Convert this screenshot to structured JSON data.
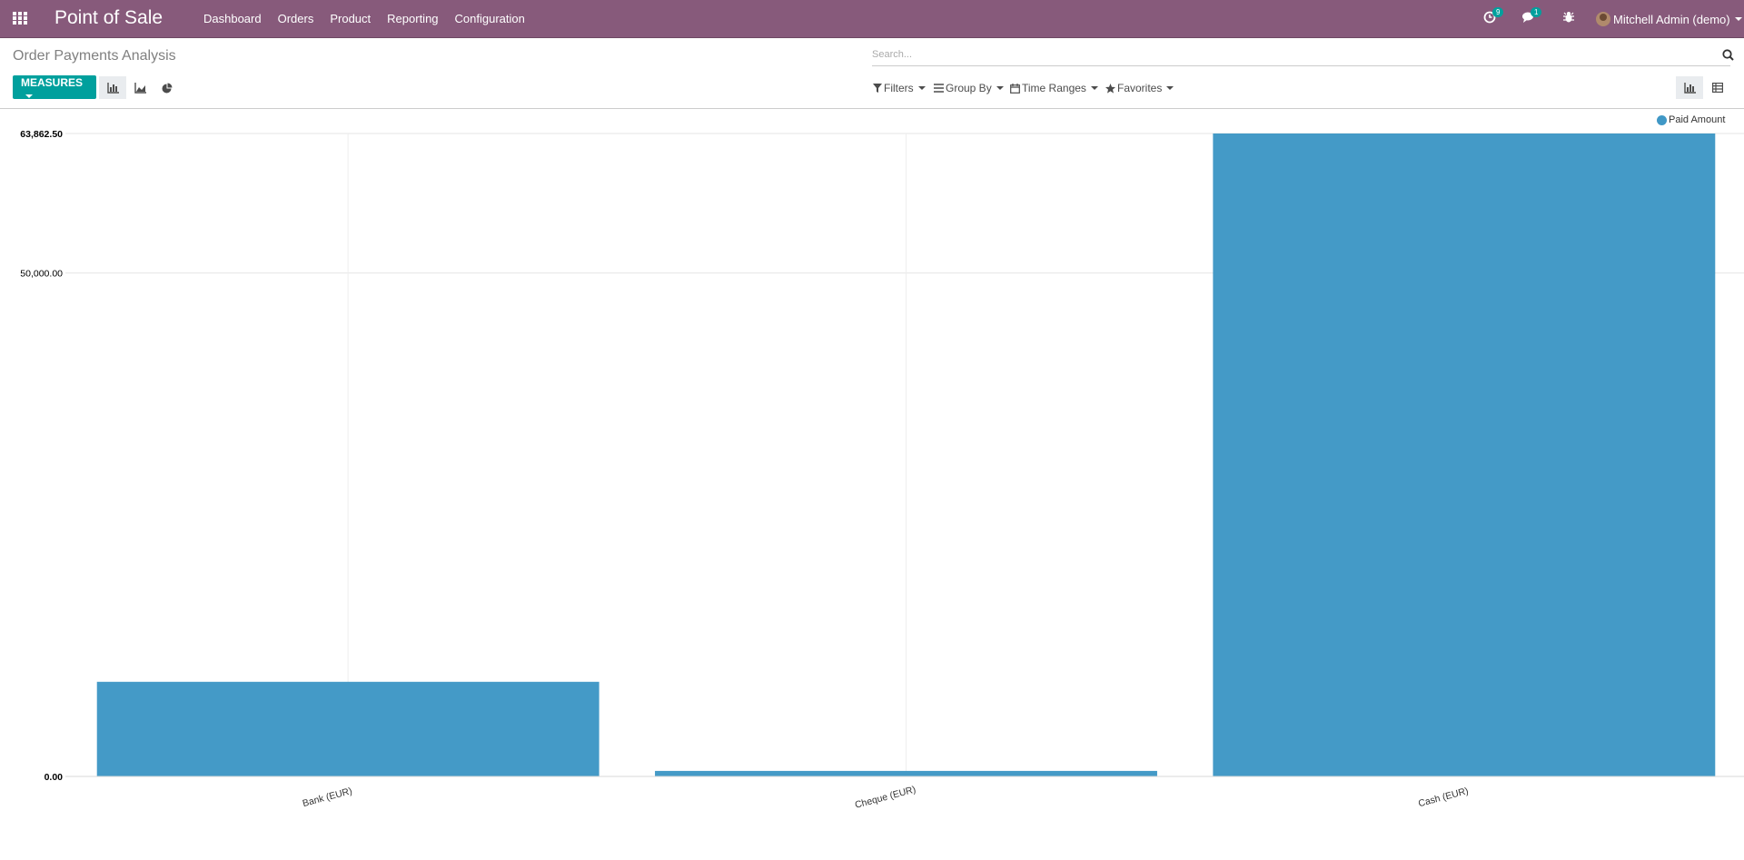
{
  "navbar": {
    "brand": "Point of Sale",
    "menu": [
      "Dashboard",
      "Orders",
      "Product",
      "Reporting",
      "Configuration"
    ],
    "activity_count": "9",
    "message_count": "1",
    "user": "Mitchell Admin (demo)"
  },
  "control_panel": {
    "title": "Order Payments Analysis",
    "search_placeholder": "Search...",
    "measures_label": "MEASURES",
    "filters_label": "Filters",
    "group_by_label": "Group By",
    "time_ranges_label": "Time Ranges",
    "favorites_label": "Favorites"
  },
  "colors": {
    "brand": "#875a7b",
    "accent": "#00a09d",
    "bar": "#4098c6"
  },
  "icons": {
    "apps": "apps-grid-icon",
    "activity": "clock-icon",
    "messages": "comments-icon",
    "debug": "bug-icon",
    "search": "search-icon",
    "bar_view": "bar-chart-icon",
    "line_view": "area-chart-icon",
    "pie_view": "pie-chart-icon",
    "graph_switch": "bar-chart-icon",
    "pivot_switch": "table-icon"
  },
  "chart_data": {
    "type": "bar",
    "categories": [
      "Bank (EUR)",
      "Cheque (EUR)",
      "Cash (EUR)"
    ],
    "series": [
      {
        "name": "Paid Amount",
        "values": [
          9400,
          550,
          63862.5
        ]
      }
    ],
    "y_ticks": [
      "63,862.50",
      "50,000.00",
      "0.00"
    ],
    "ylim": [
      0,
      63862.5
    ],
    "legend_position": "top-right",
    "grid": true
  }
}
